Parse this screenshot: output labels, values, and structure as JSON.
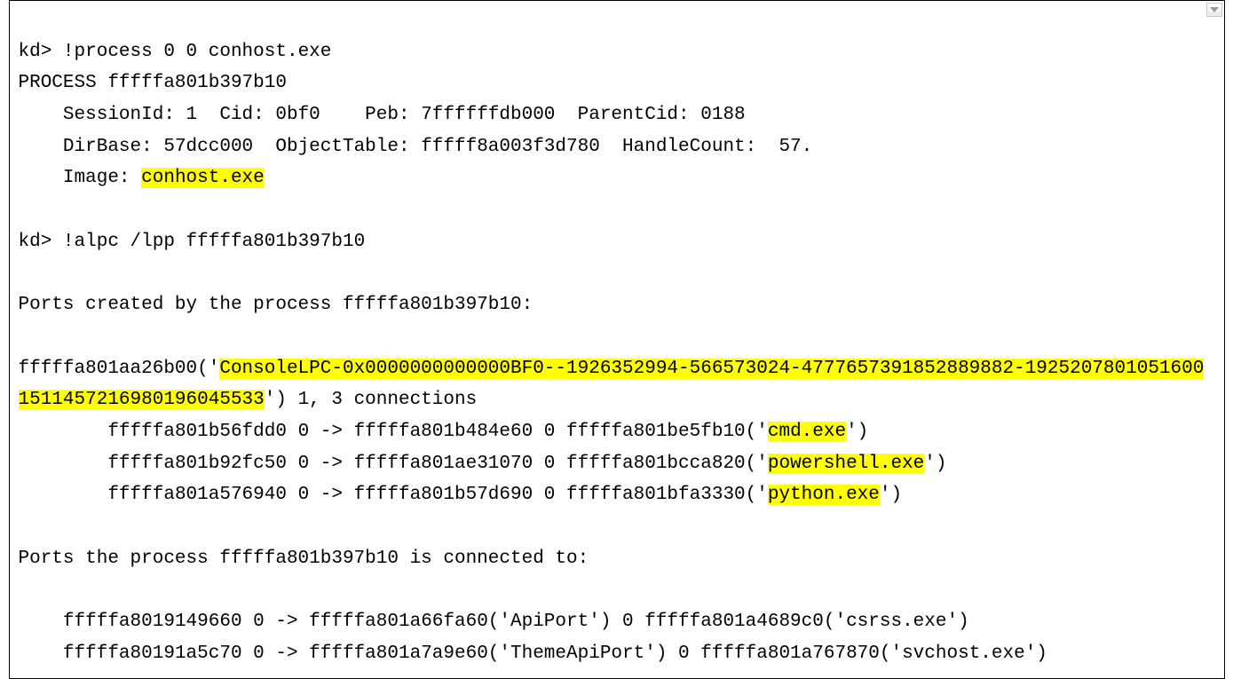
{
  "cmd1_prompt": "kd> ",
  "cmd1": "!process 0 0 conhost.exe",
  "process_line": "PROCESS fffffa801b397b10",
  "session_line": "    SessionId: 1  Cid: 0bf0    Peb: 7ffffffdb000  ParentCid: 0188",
  "dirbase_line": "    DirBase: 57dcc000  ObjectTable: fffff8a003f3d780  HandleCount:  57.",
  "image_prefix": "    Image: ",
  "image_name": "conhost.exe",
  "cmd2_prompt": "kd> ",
  "cmd2": "!alpc /lpp fffffa801b397b10",
  "ports_created_header": "Ports created by the process fffffa801b397b10:",
  "port_addr_prefix": "fffffa801aa26b00('",
  "port_name": "ConsoleLPC-0x0000000000000BF0--1926352994-566573024-4777657391852889882-1925207801051600151145721698019604553",
  "port_name_tail": "3",
  "port_suffix": "') 1, 3 connections",
  "conn1_prefix": "        fffffa801b56fdd0 0 -> fffffa801b484e60 0 fffffa801be5fb10('",
  "conn1_name": "cmd.exe",
  "conn1_suffix": "')",
  "conn2_prefix": "        fffffa801b92fc50 0 -> fffffa801ae31070 0 fffffa801bcca820('",
  "conn2_name": "powershell.exe",
  "conn2_suffix": "')",
  "conn3_prefix": "        fffffa801a576940 0 -> fffffa801b57d690 0 fffffa801bfa3330('",
  "conn3_name": "python.exe",
  "conn3_suffix": "')",
  "ports_connected_header": "Ports the process fffffa801b397b10 is connected to:",
  "connected1": "    fffffa8019149660 0 -> fffffa801a66fa60('ApiPort') 0 fffffa801a4689c0('csrss.exe')",
  "connected2": "    fffffa80191a5c70 0 -> fffffa801a7a9e60('ThemeApiPort') 0 fffffa801a767870('svchost.exe')"
}
